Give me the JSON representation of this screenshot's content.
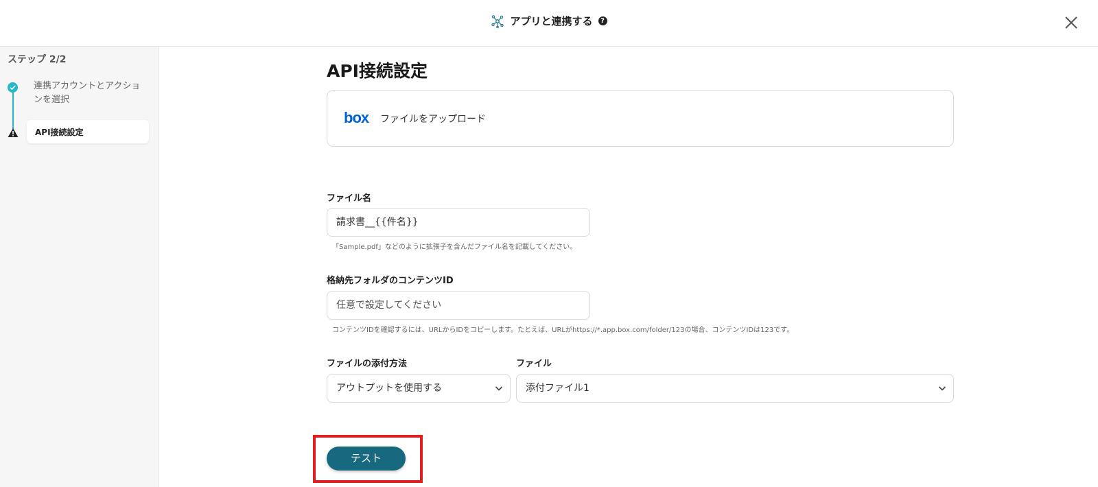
{
  "header": {
    "title": "アプリと連携する",
    "help_icon": "?",
    "icon": "network-icon",
    "close_icon": "close-icon"
  },
  "sidebar": {
    "step_label": "ステップ 2/2",
    "steps": [
      {
        "label": "連携アカウントとアクションを選択",
        "status": "complete"
      },
      {
        "label": "API接続設定",
        "status": "warning"
      }
    ]
  },
  "main": {
    "title": "API接続設定",
    "app": {
      "logo": "box",
      "action": "ファイルをアップロード"
    },
    "fields": {
      "file_name": {
        "label": "ファイル名",
        "value": "請求書__{{件名}}",
        "hint": "「Sample.pdf」などのように拡張子を含んだファイル名を記載してください。"
      },
      "folder_id": {
        "label": "格納先フォルダのコンテンツID",
        "placeholder": "任意で設定してください",
        "hint": "コンテンツIDを確認するには、URLからIDをコピーします。たとえば、URLがhttps://*.app.box.com/folder/123の場合、コンテンツIDは123です。"
      },
      "attach_method": {
        "label": "ファイルの添付方法",
        "value": "アウトプットを使用する"
      },
      "file": {
        "label": "ファイル",
        "value": "添付ファイル1"
      }
    },
    "test_button": "テスト"
  },
  "colors": {
    "accent": "#16697f",
    "step_complete": "#27b8c8",
    "highlight": "#e02020",
    "box_brand": "#0061d5"
  }
}
